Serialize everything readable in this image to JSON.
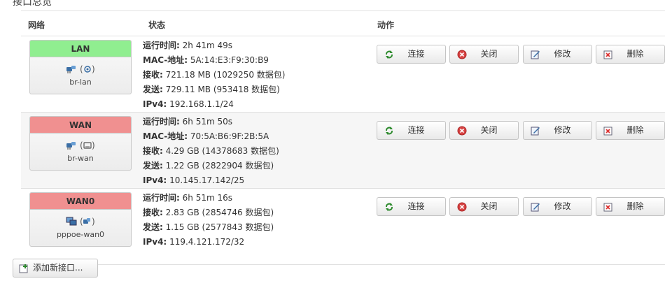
{
  "section": {
    "title": "接口总览"
  },
  "table": {
    "headers": {
      "network": "网络",
      "status": "状态",
      "actions": "动作"
    },
    "labels": {
      "uptime": "运行时间:",
      "mac": "MAC-地址:",
      "rx": "接收:",
      "tx": "发送:",
      "ipv4": "IPv4:"
    },
    "action_labels": {
      "connect": "连接",
      "stop": "关闭",
      "edit": "修改",
      "delete": "删除"
    },
    "rows": [
      {
        "name": "LAN",
        "color": "#90ee90",
        "device": "br-lan",
        "uptime": "2h 41m 49s",
        "mac": "5A:14:E3:F9:30:B9",
        "rx": "721.18 MB (1029250 数据包)",
        "tx": "729.11 MB (953418 数据包)",
        "ipv4": "192.168.1.1/24",
        "icons": [
          "ethernet-icon",
          "wifi-icon"
        ]
      },
      {
        "name": "WAN",
        "color": "#f09090",
        "device": "br-wan",
        "uptime": "6h 51m 50s",
        "mac": "70:5A:B6:9F:2B:5A",
        "rx": "4.29 GB (14378683 数据包)",
        "tx": "1.22 GB (2822904 数据包)",
        "ipv4": "10.145.17.142/25",
        "icons": [
          "ethernet-icon",
          "ethernet-icon"
        ]
      },
      {
        "name": "WAN0",
        "color": "#f09090",
        "device": "pppoe-wan0",
        "uptime": "6h 51m 16s",
        "mac": "",
        "rx": "2.83 GB (2854746 数据包)",
        "tx": "1.15 GB (2577843 数据包)",
        "ipv4": "119.4.121.172/32",
        "icons": [
          "ppp-icon",
          "ethernet-icon"
        ]
      }
    ]
  },
  "add_button": {
    "label": "添加新接口..."
  }
}
